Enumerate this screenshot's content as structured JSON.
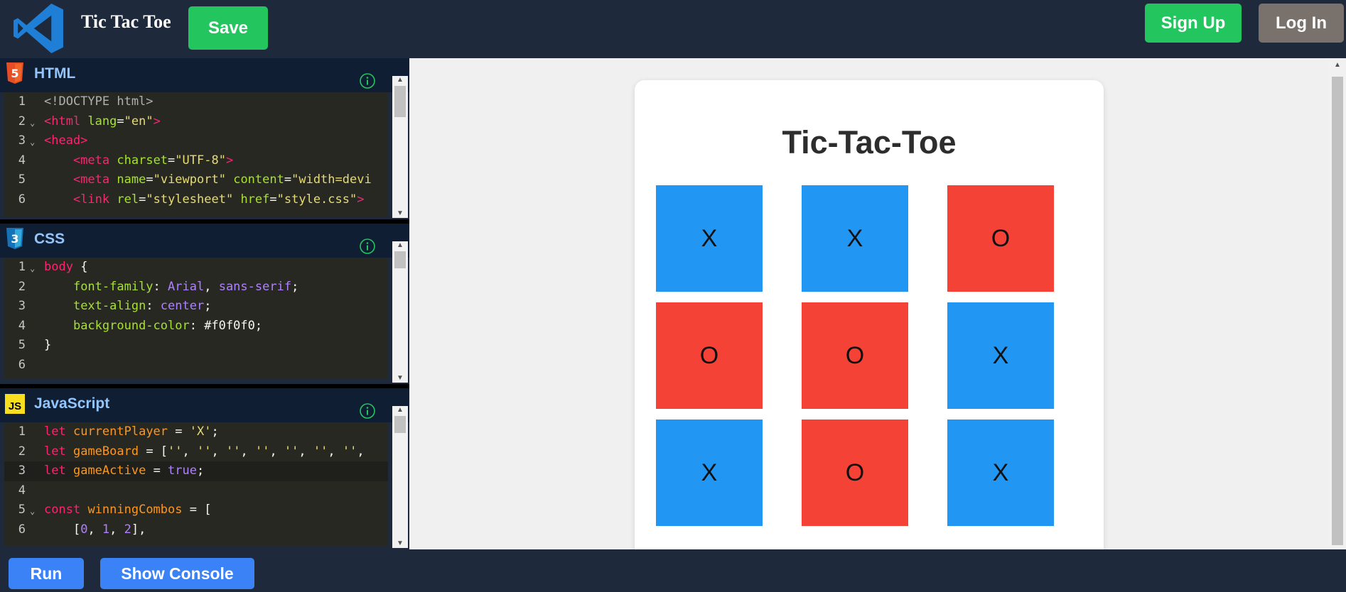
{
  "header": {
    "logo_icon": "vscode-logo-icon",
    "title": "Tic Tac Toe",
    "save_label": "Save",
    "signup_label": "Sign Up",
    "login_label": "Log In"
  },
  "panels": {
    "html": {
      "title": "HTML",
      "icon": "html5-icon",
      "lines": [
        "1",
        "2",
        "3",
        "4",
        "5",
        "6"
      ]
    },
    "css": {
      "title": "CSS",
      "icon": "css3-icon",
      "lines": [
        "1",
        "2",
        "3",
        "4",
        "5",
        "6"
      ]
    },
    "js": {
      "title": "JavaScript",
      "icon": "js-icon",
      "icon_text": "JS",
      "lines": [
        "1",
        "2",
        "3",
        "4",
        "5",
        "6"
      ]
    }
  },
  "preview": {
    "title": "Tic-Tac-Toe",
    "board": [
      "X",
      "X",
      "O",
      "O",
      "O",
      "X",
      "X",
      "O",
      "X"
    ]
  },
  "footer": {
    "run_label": "Run",
    "console_label": "Show Console"
  },
  "colors": {
    "x_cell": "#2196f3",
    "o_cell": "#f44336",
    "green_button": "#22c55e",
    "blue_button": "#3b82f6",
    "gray_button": "#78716c"
  }
}
